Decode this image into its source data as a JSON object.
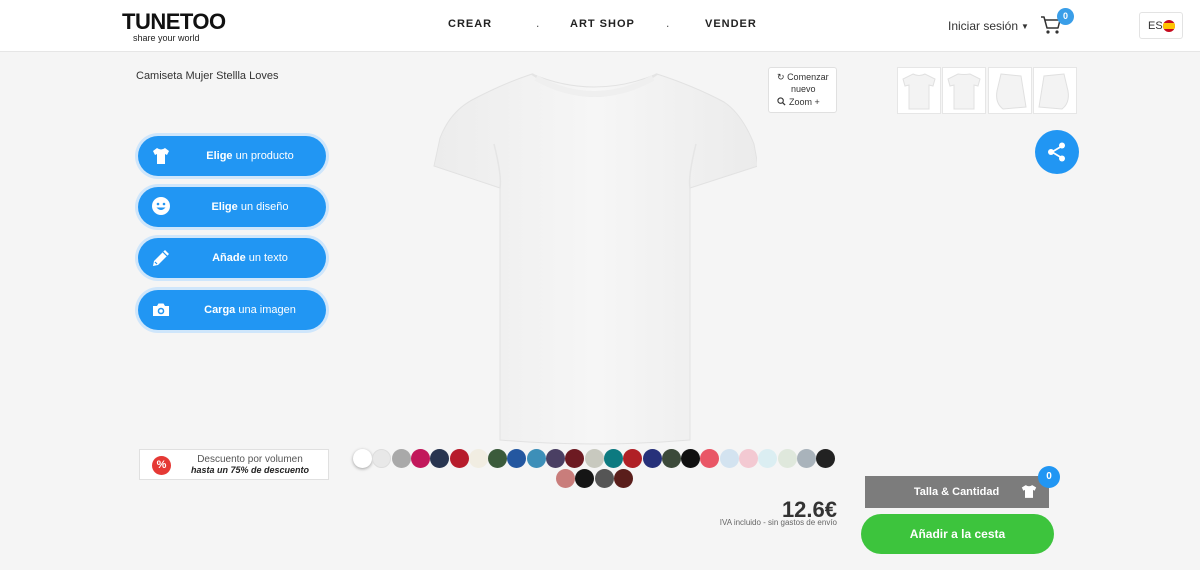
{
  "header": {
    "logo_word": "TUNETOO",
    "logo_tagline": "share your world",
    "nav": [
      {
        "label": "CREAR"
      },
      {
        "label": "ART SHOP"
      },
      {
        "label": "VENDER"
      }
    ],
    "nav_separator": ".",
    "login_label": "Iniciar sesión",
    "cart_count": "0",
    "language": "ES"
  },
  "product": {
    "title": "Camiseta Mujer Stellla Loves"
  },
  "actions": [
    {
      "bold": "Elige",
      "rest": " un producto",
      "icon": "tshirt-icon"
    },
    {
      "bold": "Elige",
      "rest": " un diseño",
      "icon": "smiley-icon"
    },
    {
      "bold": "Añade",
      "rest": " un texto",
      "icon": "pencil-icon"
    },
    {
      "bold": "Carga",
      "rest": " una imagen",
      "icon": "camera-icon"
    }
  ],
  "tools": {
    "restart_line1": "Comenzar",
    "restart_line2": "nuevo",
    "zoom": "Zoom +"
  },
  "discount": {
    "badge": "%",
    "line1": "Descuento por volumen",
    "line2": "hasta un 75% de descuento"
  },
  "swatch_colors": [
    "#ffffff",
    "#e8e8e8",
    "#a9a9a9",
    "#c2185b",
    "#283550",
    "#b71c2c",
    "#f1ede2",
    "#3b5b3b",
    "#2457a0",
    "#3d8fb8",
    "#4a3f63",
    "#6d1a22",
    "#c8c9bf",
    "#0d7a80",
    "#b02026",
    "#27317a",
    "#3c4a3a",
    "#111111",
    "#e95666",
    "#d3e3f0",
    "#f3c9d2",
    "#dbeef2",
    "#dfe8dc",
    "#a9b3bb",
    "#222222",
    "#c97d7b",
    "#151515",
    "#555555",
    "#5a1e1b"
  ],
  "price": {
    "amount": "12.6€",
    "vat_note": "IVA incluido - sin gastos de envío"
  },
  "size_button": {
    "label": "Talla & Cantidad",
    "count": "0"
  },
  "add_to_cart": "Añadir a la cesta",
  "colors": {
    "primary": "#2196f3",
    "cta": "#3dc43d",
    "size_bg": "#7c7c7c",
    "discount_badge": "#e53935"
  }
}
